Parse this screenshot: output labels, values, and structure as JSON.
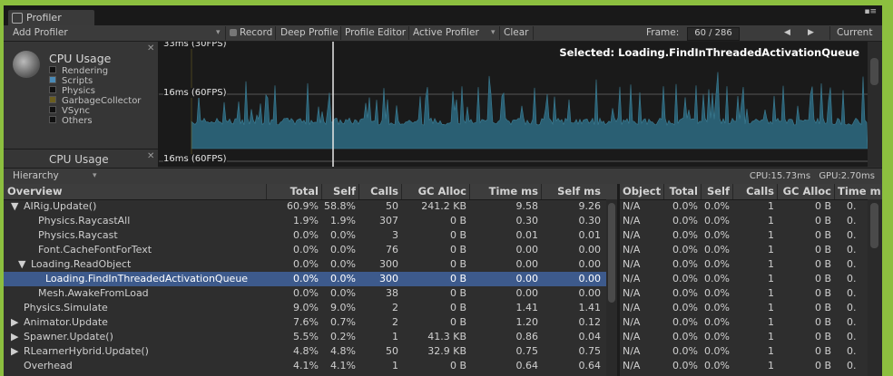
{
  "window": {
    "tab_title": "Profiler",
    "menu_glyph": "▪≡"
  },
  "toolbar": {
    "add_profiler": "Add Profiler",
    "add_profiler_arrow": "▾",
    "record": "Record",
    "deep_profile": "Deep Profile",
    "profile_editor": "Profile Editor",
    "active_profiler": "Active Profiler",
    "active_profiler_arrow": "▾",
    "clear": "Clear",
    "frame_label": "Frame:",
    "frame_value": "60 / 286",
    "prev": "◀",
    "next": "▶",
    "current": "Current"
  },
  "module": {
    "title": "CPU Usage",
    "title2": "CPU Usage",
    "close": "✕",
    "legend": [
      {
        "label": "Rendering",
        "color": "#111111"
      },
      {
        "label": "Scripts",
        "color": "#4a8bb8"
      },
      {
        "label": "Physics",
        "color": "#111111"
      },
      {
        "label": "GarbageCollector",
        "color": "#6b5e1f"
      },
      {
        "label": "VSync",
        "color": "#111111"
      },
      {
        "label": "Others",
        "color": "#111111"
      }
    ]
  },
  "graph": {
    "top_label": "33ms (30FPS)",
    "mid_label": "16ms (60FPS)",
    "bottom_label": "16ms (60FPS)",
    "selected": "Selected: Loading.FindInThreadedActivationQueue",
    "bar_color": "#2a5f73"
  },
  "hierarchy": {
    "view": "Hierarchy",
    "view_arrow": "▾",
    "cpu": "CPU:15.73ms",
    "gpu": "GPU:2.70ms",
    "columns": [
      "Overview",
      "Total",
      "Self",
      "Calls",
      "GC Alloc",
      "Time ms",
      "Self ms"
    ],
    "rows": [
      {
        "arrow": "▼",
        "indent": 0,
        "name": "AIRig.Update()",
        "total": "60.9%",
        "self": "58.8%",
        "calls": "50",
        "gc": "241.2 KB",
        "time": "9.58",
        "selfms": "9.26"
      },
      {
        "arrow": "",
        "indent": 2,
        "name": "Physics.RaycastAll",
        "total": "1.9%",
        "self": "1.9%",
        "calls": "307",
        "gc": "0 B",
        "time": "0.30",
        "selfms": "0.30"
      },
      {
        "arrow": "",
        "indent": 2,
        "name": "Physics.Raycast",
        "total": "0.0%",
        "self": "0.0%",
        "calls": "3",
        "gc": "0 B",
        "time": "0.01",
        "selfms": "0.01"
      },
      {
        "arrow": "",
        "indent": 2,
        "name": "Font.CacheFontForText",
        "total": "0.0%",
        "self": "0.0%",
        "calls": "76",
        "gc": "0 B",
        "time": "0.00",
        "selfms": "0.00"
      },
      {
        "arrow": "▼",
        "indent": 1,
        "name": "Loading.ReadObject",
        "total": "0.0%",
        "self": "0.0%",
        "calls": "300",
        "gc": "0 B",
        "time": "0.00",
        "selfms": "0.00"
      },
      {
        "arrow": "",
        "indent": 3,
        "name": "Loading.FindInThreadedActivationQueue",
        "total": "0.0%",
        "self": "0.0%",
        "calls": "300",
        "gc": "0 B",
        "time": "0.00",
        "selfms": "0.00",
        "selected": true
      },
      {
        "arrow": "",
        "indent": 2,
        "name": "Mesh.AwakeFromLoad",
        "total": "0.0%",
        "self": "0.0%",
        "calls": "38",
        "gc": "0 B",
        "time": "0.00",
        "selfms": "0.00"
      },
      {
        "arrow": "",
        "indent": 0,
        "name": "Physics.Simulate",
        "total": "9.0%",
        "self": "9.0%",
        "calls": "2",
        "gc": "0 B",
        "time": "1.41",
        "selfms": "1.41"
      },
      {
        "arrow": "▶",
        "indent": 0,
        "name": "Animator.Update",
        "total": "7.6%",
        "self": "0.7%",
        "calls": "2",
        "gc": "0 B",
        "time": "1.20",
        "selfms": "0.12"
      },
      {
        "arrow": "▶",
        "indent": 0,
        "name": "Spawner.Update()",
        "total": "5.5%",
        "self": "0.2%",
        "calls": "1",
        "gc": "41.3 KB",
        "time": "0.86",
        "selfms": "0.04"
      },
      {
        "arrow": "▶",
        "indent": 0,
        "name": "RLearnerHybrid.Update()",
        "total": "4.8%",
        "self": "4.8%",
        "calls": "50",
        "gc": "32.9 KB",
        "time": "0.75",
        "selfms": "0.75"
      },
      {
        "arrow": "",
        "indent": 0,
        "name": "Overhead",
        "total": "4.1%",
        "self": "4.1%",
        "calls": "1",
        "gc": "0 B",
        "time": "0.64",
        "selfms": "0.64"
      }
    ]
  },
  "details": {
    "columns": [
      "Object",
      "Total",
      "Self",
      "Calls",
      "GC Alloc",
      "Time m"
    ],
    "row": {
      "object": "N/A",
      "total": "0.0%",
      "self": "0.0%",
      "calls": "1",
      "gc": "0 B",
      "time": "0."
    }
  }
}
